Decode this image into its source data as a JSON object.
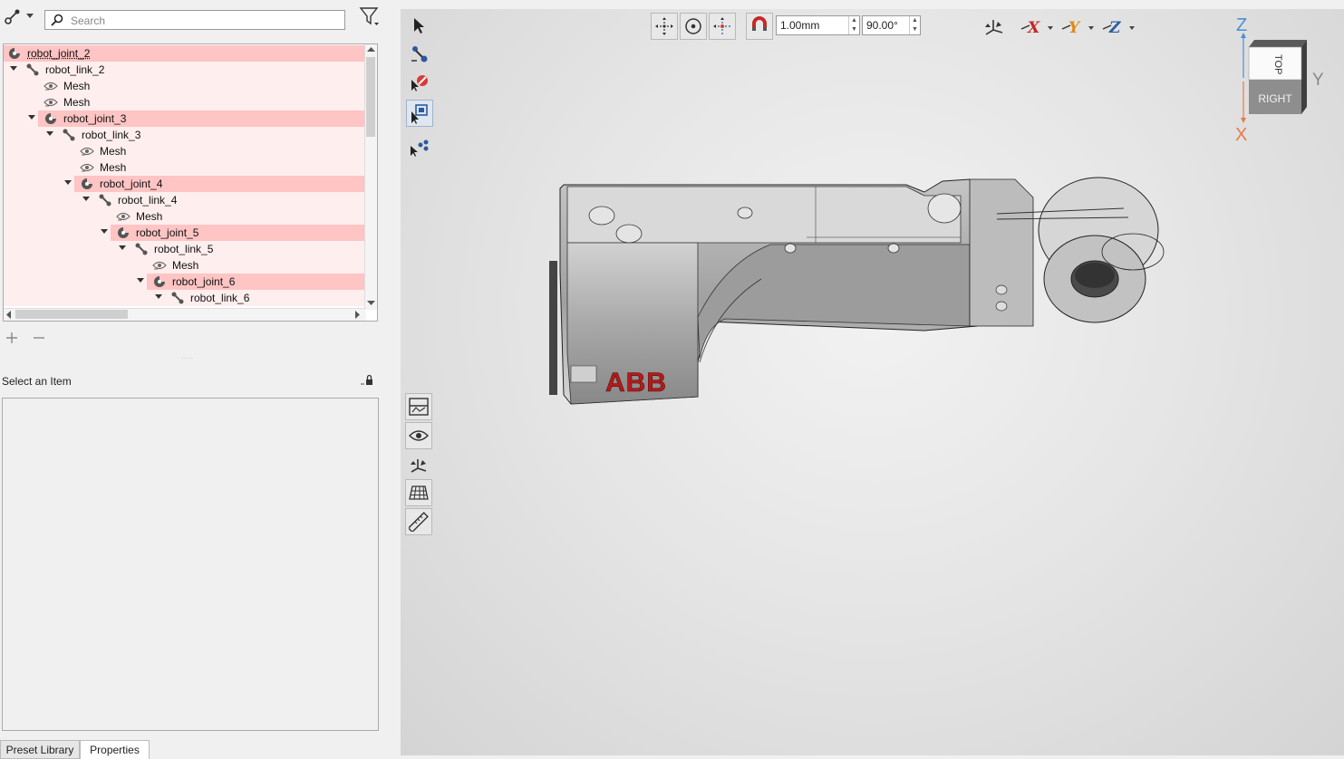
{
  "search": {
    "placeholder": "Search"
  },
  "tree": {
    "items": [
      {
        "label": "robot_joint_2",
        "kind": "joint",
        "depth": 0,
        "expanded": null,
        "selected": true
      },
      {
        "label": "robot_link_2",
        "kind": "link",
        "depth": 1,
        "expanded": true,
        "selected": false
      },
      {
        "label": "Mesh",
        "kind": "mesh",
        "depth": 2,
        "expanded": null,
        "selected": false
      },
      {
        "label": "Mesh",
        "kind": "mesh",
        "depth": 2,
        "expanded": null,
        "selected": false
      },
      {
        "label": "robot_joint_3",
        "kind": "joint",
        "depth": 2,
        "expanded": true,
        "selected": true
      },
      {
        "label": "robot_link_3",
        "kind": "link",
        "depth": 3,
        "expanded": true,
        "selected": false
      },
      {
        "label": "Mesh",
        "kind": "mesh",
        "depth": 4,
        "expanded": null,
        "selected": false
      },
      {
        "label": "Mesh",
        "kind": "mesh",
        "depth": 4,
        "expanded": null,
        "selected": false
      },
      {
        "label": "robot_joint_4",
        "kind": "joint",
        "depth": 4,
        "expanded": true,
        "selected": true
      },
      {
        "label": "robot_link_4",
        "kind": "link",
        "depth": 5,
        "expanded": true,
        "selected": false
      },
      {
        "label": "Mesh",
        "kind": "mesh",
        "depth": 6,
        "expanded": null,
        "selected": false
      },
      {
        "label": "robot_joint_5",
        "kind": "joint",
        "depth": 6,
        "expanded": true,
        "selected": true
      },
      {
        "label": "robot_link_5",
        "kind": "link",
        "depth": 7,
        "expanded": true,
        "selected": false
      },
      {
        "label": "Mesh",
        "kind": "mesh",
        "depth": 8,
        "expanded": null,
        "selected": false
      },
      {
        "label": "robot_joint_6",
        "kind": "joint",
        "depth": 8,
        "expanded": true,
        "selected": true
      },
      {
        "label": "robot_link_6",
        "kind": "link",
        "depth": 9,
        "expanded": true,
        "selected": false
      }
    ]
  },
  "properties": {
    "title": "Select an Item"
  },
  "tabs": [
    {
      "label": "Preset Library",
      "active": false
    },
    {
      "label": "Properties",
      "active": true
    }
  ],
  "snap": {
    "distance": "1.00mm",
    "angle": "90.00°"
  },
  "viewcube": {
    "top_label": "TOP",
    "right_label": "RIGHT",
    "axis_z": "Z",
    "axis_x": "X",
    "axis_y": "Y"
  },
  "model": {
    "logo_text": "ABB"
  },
  "colors": {
    "selection_bg": "#ffc4c4",
    "row_bg": "#ffeeee",
    "axis_z": "#4a8fd8",
    "axis_x": "#e8794a",
    "logo_red": "#b31b1b"
  }
}
